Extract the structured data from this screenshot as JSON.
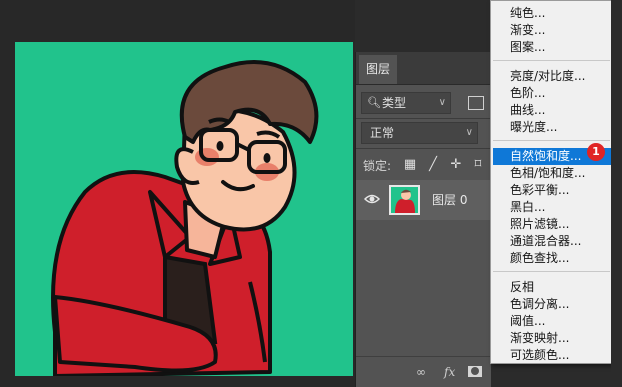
{
  "layers_panel": {
    "tab_title": "图层",
    "filter_kind": "类型",
    "blend_mode": "正常",
    "lock_label": "锁定:",
    "layer": {
      "name": "图层 0",
      "visible": true
    },
    "footer_icons": [
      "link-icon",
      "fx-icon",
      "mask-icon"
    ]
  },
  "adjustments_menu": {
    "groups": [
      [
        "纯色...",
        "渐变...",
        "图案..."
      ],
      [
        "亮度/对比度...",
        "色阶...",
        "曲线...",
        "曝光度..."
      ],
      [
        "自然饱和度...",
        "色相/饱和度...",
        "色彩平衡...",
        "黑白...",
        "照片滤镜...",
        "通道混合器...",
        "颜色查找..."
      ],
      [
        "反相",
        "色调分离...",
        "阈值...",
        "渐变映射...",
        "可选颜色..."
      ]
    ],
    "highlighted_item": "自然饱和度...",
    "step_badge": "1"
  },
  "colors": {
    "canvas_background": "#21c38c",
    "highlight": "#0f78d7",
    "badge": "#e02424"
  }
}
